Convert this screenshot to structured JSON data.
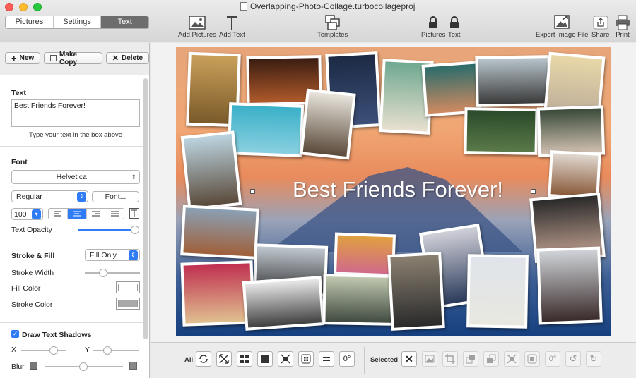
{
  "window": {
    "title": "Overlapping-Photo-Collage.turbocollageproj"
  },
  "mode_tabs": [
    {
      "label": "Pictures",
      "active": false
    },
    {
      "label": "Settings",
      "active": false
    },
    {
      "label": "Text",
      "active": true
    }
  ],
  "toolbar": {
    "add_pictures": "Add Pictures",
    "add_text": "Add Text",
    "templates": "Templates",
    "lock_pictures": "Pictures",
    "lock_text": "Text",
    "export": "Export Image File",
    "share": "Share",
    "print": "Print"
  },
  "left_panel": {
    "new": "New",
    "make_copy": "Make Copy",
    "delete": "Delete",
    "text_section": "Text",
    "text_value": "Best Friends Forever!",
    "text_hint": "Type your text in the box above",
    "font_section": "Font",
    "font_family": "Helvetica",
    "font_style": "Regular",
    "font_button": "Font...",
    "font_size": "100",
    "alignment": "center",
    "text_opacity_label": "Text Opacity",
    "text_opacity": 1.0,
    "stroke_fill_label": "Stroke & Fill",
    "stroke_fill_value": "Fill Only",
    "stroke_width_label": "Stroke Width",
    "fill_color_label": "Fill Color",
    "fill_color": "#ffffff",
    "stroke_color_label": "Stroke Color",
    "stroke_color": "#a9a9a9",
    "shadow_label": "Draw Text Shadows",
    "shadow_checked": true,
    "x_label": "X",
    "y_label": "Y",
    "blur_label": "Blur"
  },
  "canvas": {
    "text": "Best Friends Forever!"
  },
  "bottom_bar": {
    "all_label": "All",
    "selected_label": "Selected"
  },
  "colors": {
    "accent": "#2f7cf6",
    "tab_active": "#6d6d6d"
  }
}
